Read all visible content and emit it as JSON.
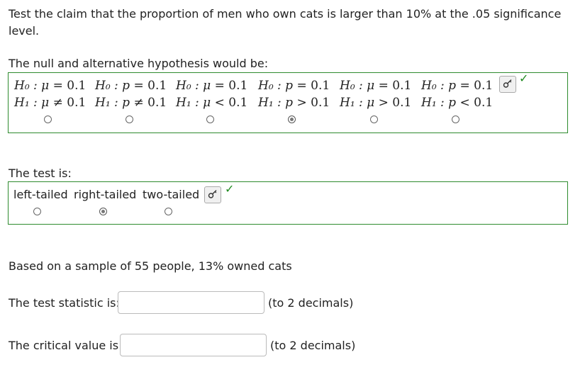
{
  "question": {
    "prompt": "Test the claim that the proportion of men who own cats is larger than 10% at the .05 significance level."
  },
  "hypothesis": {
    "label": "The null and alternative hypothesis would be:",
    "options": [
      {
        "h0_lhs": "H₀ : μ",
        "h0_rel": "=",
        "h0_rhs": "0.1",
        "h1_lhs": "H₁ : μ",
        "h1_rel": "≠",
        "h1_rhs": "0.1",
        "selected": false
      },
      {
        "h0_lhs": "H₀ : p",
        "h0_rel": "=",
        "h0_rhs": "0.1",
        "h1_lhs": "H₁ : p",
        "h1_rel": "≠",
        "h1_rhs": "0.1",
        "selected": false
      },
      {
        "h0_lhs": "H₀ : μ",
        "h0_rel": "=",
        "h0_rhs": "0.1",
        "h1_lhs": "H₁ : μ",
        "h1_rel": "<",
        "h1_rhs": "0.1",
        "selected": false
      },
      {
        "h0_lhs": "H₀ : p",
        "h0_rel": "=",
        "h0_rhs": "0.1",
        "h1_lhs": "H₁ : p",
        "h1_rel": ">",
        "h1_rhs": "0.1",
        "selected": true
      },
      {
        "h0_lhs": "H₀ : μ",
        "h0_rel": "=",
        "h0_rhs": "0.1",
        "h1_lhs": "H₁ : μ",
        "h1_rel": ">",
        "h1_rhs": "0.1",
        "selected": false
      },
      {
        "h0_lhs": "H₀ : p",
        "h0_rel": "=",
        "h0_rhs": "0.1",
        "h1_lhs": "H₁ : p",
        "h1_rel": "<",
        "h1_rhs": "0.1",
        "selected": false
      }
    ],
    "key_icon": "key-icon",
    "status_icon": "checkmark-icon"
  },
  "test_type": {
    "label": "The test is:",
    "options": [
      {
        "label": "left-tailed",
        "selected": false
      },
      {
        "label": "right-tailed",
        "selected": true
      },
      {
        "label": "two-tailed",
        "selected": false
      }
    ],
    "key_icon": "key-icon",
    "status_icon": "checkmark-icon"
  },
  "sample": {
    "text": "Based on a sample of 55 people, 13% owned cats"
  },
  "test_statistic": {
    "label": "The test statistic is:",
    "value": "",
    "hint": "(to 2 decimals)"
  },
  "critical_value": {
    "label": "The critical value is:",
    "value": "",
    "hint": "(to 2 decimals)"
  },
  "colors": {
    "correct_border": "#2e8b2e",
    "check": "#1f8a1f"
  },
  "glyphs": {
    "check": "✓"
  }
}
